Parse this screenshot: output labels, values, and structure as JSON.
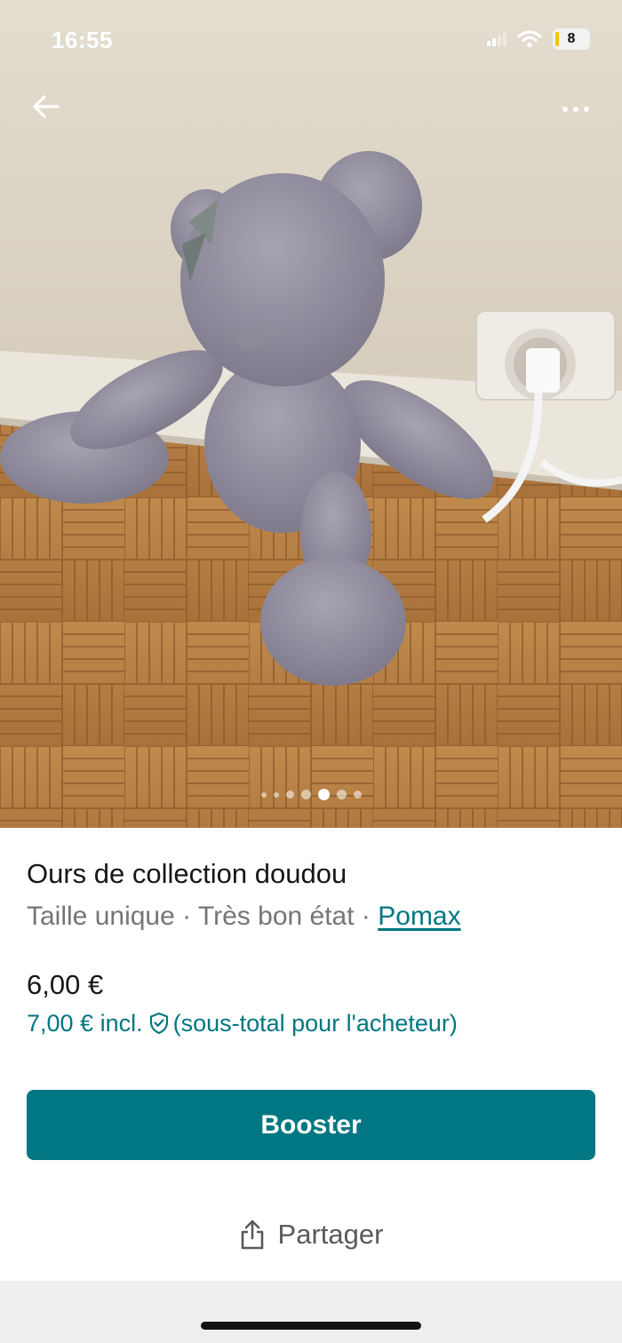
{
  "status_bar": {
    "time": "16:55",
    "battery": "8"
  },
  "photo": {
    "subject": "grey plush teddy bear on parquet floor",
    "pager": {
      "count": 7,
      "active_index": 4
    }
  },
  "nav": {
    "back_icon": "arrow-left-icon",
    "more_icon": "more-horizontal-icon"
  },
  "item": {
    "title": "Ours de collection doudou",
    "size": "Taille unique",
    "separator": " · ",
    "condition": "Très bon état",
    "brand": "Pomax"
  },
  "pricing": {
    "price": "6,00 €",
    "buyer_total_prefix": "7,00 € incl.",
    "buyer_total_suffix": "(sous-total pour l'acheteur)",
    "protection_icon": "shield-check-icon"
  },
  "actions": {
    "booster_label": "Booster",
    "share_label": "Partager",
    "share_icon": "share-icon"
  },
  "colors": {
    "accent": "#007782",
    "text_primary": "#171717",
    "text_secondary": "#757575"
  }
}
